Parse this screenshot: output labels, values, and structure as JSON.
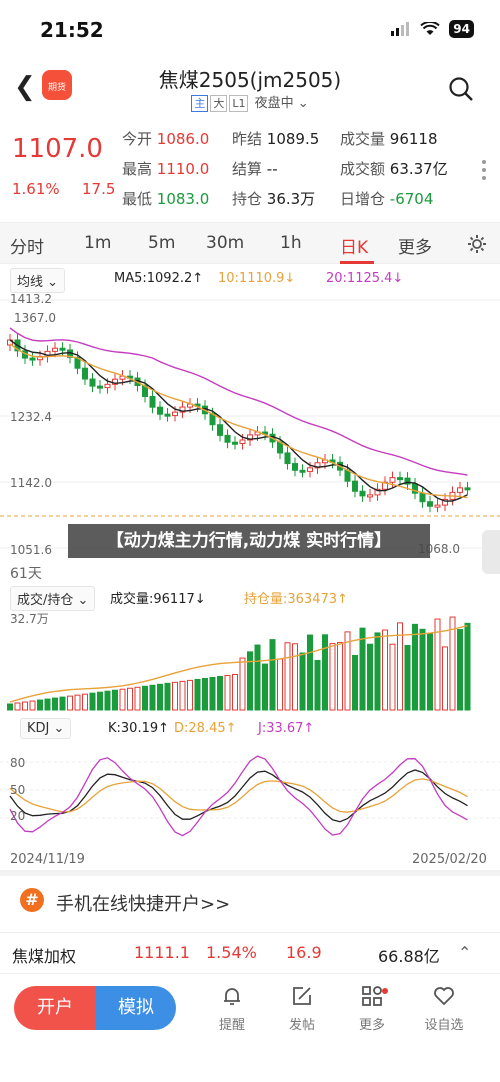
{
  "status": {
    "time": "21:52",
    "battery": "94"
  },
  "nav": {
    "logo": "期货",
    "title": "焦煤2505(jm2505)",
    "tags": [
      "主",
      "大",
      "L1"
    ],
    "session": "夜盘中"
  },
  "quote": {
    "price": "1107.0",
    "pct": "1.61%",
    "change": "17.5",
    "rows": [
      [
        {
          "k": "今开",
          "v": "1086.0",
          "c": "red"
        },
        {
          "k": "昨结",
          "v": "1089.5",
          "c": "dark"
        },
        {
          "k": "成交量",
          "v": "96118",
          "c": "dark"
        }
      ],
      [
        {
          "k": "最高",
          "v": "1110.0",
          "c": "red"
        },
        {
          "k": "结算",
          "v": "--",
          "c": "dark"
        },
        {
          "k": "成交额",
          "v": "63.37亿",
          "c": "dark"
        }
      ],
      [
        {
          "k": "最低",
          "v": "1083.0",
          "c": "green"
        },
        {
          "k": "持仓",
          "v": "36.3万",
          "c": "dark"
        },
        {
          "k": "日增仓",
          "v": "-6704",
          "c": "green"
        }
      ]
    ]
  },
  "tabs": [
    "分时",
    "1m",
    "5m",
    "30m",
    "1h",
    "日K",
    "更多"
  ],
  "active_tab": "日K",
  "kline": {
    "ma_select": "均线",
    "legend": [
      {
        "t": "MA5:1092.2↑",
        "c": "#222"
      },
      {
        "t": "10:1110.9↓",
        "c": "#e8a23a"
      },
      {
        "t": "20:1125.4↓",
        "c": "#c43cc0"
      }
    ],
    "y_labels": [
      "1413.2",
      "1232.4",
      "1142.0",
      "1051.6"
    ],
    "high_label": "1367.0",
    "low_label": "1068.0",
    "days": "61天"
  },
  "banner": "【动力煤主力行情,动力煤 实时行情】",
  "volume": {
    "select": "成交/持仓",
    "legend": [
      {
        "t": "成交量:96117↓",
        "c": "#222"
      },
      {
        "t": "持仓量:363473↑",
        "c": "#e8a23a"
      }
    ],
    "ymax": "32.7万"
  },
  "kdj": {
    "select": "KDJ",
    "legend": [
      {
        "t": "K:30.19↑",
        "c": "#222"
      },
      {
        "t": "D:28.45↑",
        "c": "#e8a23a"
      },
      {
        "t": "J:33.67↑",
        "c": "#c43cc0"
      }
    ],
    "y_labels": [
      "80",
      "50",
      "20"
    ],
    "date_start": "2024/11/19",
    "date_end": "2025/02/20"
  },
  "colors": {
    "up": "#e53935",
    "down": "#1a9b3c",
    "ma10": "#e8a23a",
    "ma20": "#c43cc0"
  },
  "promo": {
    "icon": "#",
    "text": "手机在线快捷开户>>"
  },
  "ticker": {
    "name": "焦煤加权",
    "price": "1111.1",
    "pct": "1.54%",
    "change": "16.9",
    "amount": "66.88亿"
  },
  "bottom": {
    "open": "开户",
    "sim": "模拟",
    "items": [
      {
        "label": "提醒",
        "icon": "bell-icon"
      },
      {
        "label": "发帖",
        "icon": "post-icon"
      },
      {
        "label": "更多",
        "icon": "apps-icon"
      },
      {
        "label": "设自选",
        "icon": "heart-icon"
      }
    ]
  }
}
